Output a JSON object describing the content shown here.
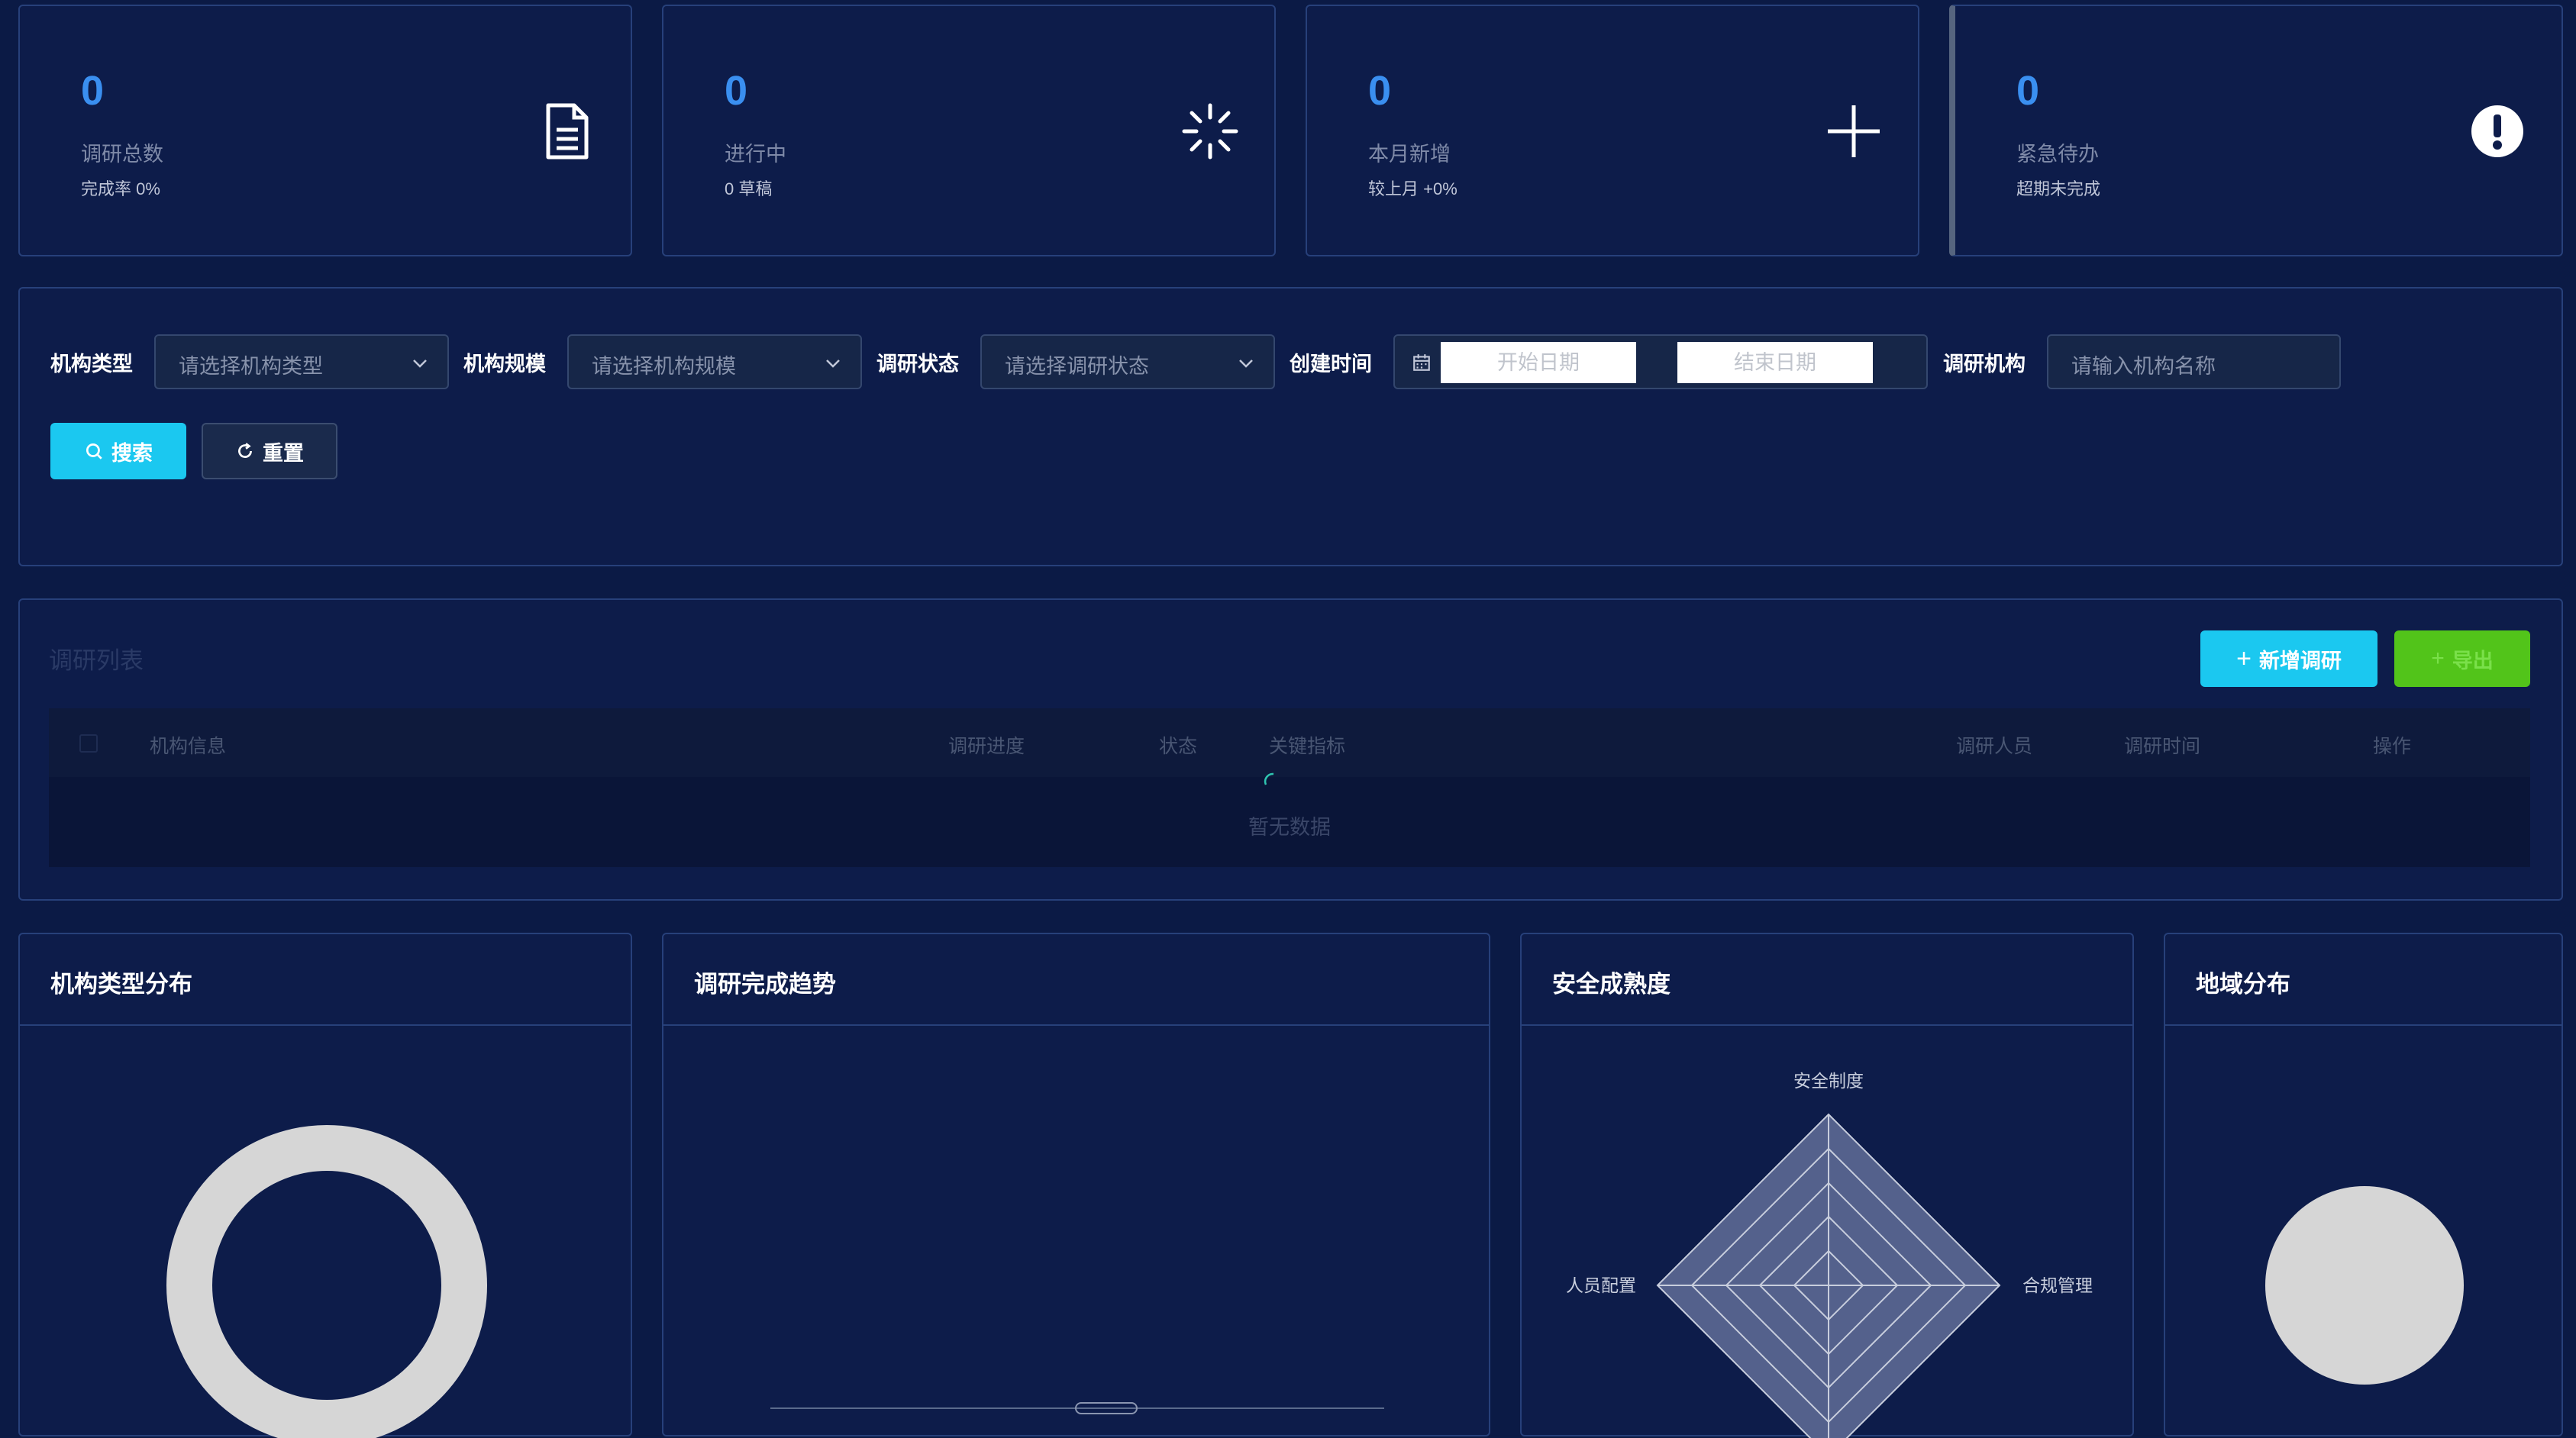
{
  "stats": [
    {
      "value": "0",
      "label": "调研总数",
      "sub": "完成率 0%",
      "icon": "document-icon"
    },
    {
      "value": "0",
      "label": "进行中",
      "sub": "0 草稿",
      "icon": "loading-icon"
    },
    {
      "value": "0",
      "label": "本月新增",
      "sub": "较上月 +0%",
      "icon": "plus-icon"
    },
    {
      "value": "0",
      "label": "紧急待办",
      "sub": "超期未完成",
      "icon": "exclamation-icon"
    }
  ],
  "filters": {
    "org_type": {
      "label": "机构类型",
      "placeholder": "请选择机构类型"
    },
    "org_scale": {
      "label": "机构规模",
      "placeholder": "请选择机构规模"
    },
    "status": {
      "label": "调研状态",
      "placeholder": "请选择调研状态"
    },
    "created": {
      "label": "创建时间",
      "start_placeholder": "开始日期",
      "end_placeholder": "结束日期"
    },
    "org": {
      "label": "调研机构",
      "placeholder": "请输入机构名称"
    },
    "search_label": "搜索",
    "reset_label": "重置"
  },
  "table": {
    "title": "调研列表",
    "add_label": "新增调研",
    "export_label": "导出",
    "columns": [
      "机构信息",
      "调研进度",
      "状态",
      "关键指标",
      "调研人员",
      "调研时间",
      "操作"
    ],
    "rows": [],
    "empty_text": "暂无数据"
  },
  "panels": {
    "org_type": "机构类型分布",
    "trend": "调研完成趋势",
    "maturity": "安全成熟度",
    "region": "地域分布"
  },
  "radar": {
    "indicators": [
      "安全制度",
      "合规管理",
      "人员配置"
    ]
  },
  "colors": {
    "background": "#0b1a45",
    "card": "#0d1c4a",
    "accent_blue": "#3a8ff0",
    "cyan_button": "#1bc8f0",
    "green_button": "#52c41a"
  }
}
